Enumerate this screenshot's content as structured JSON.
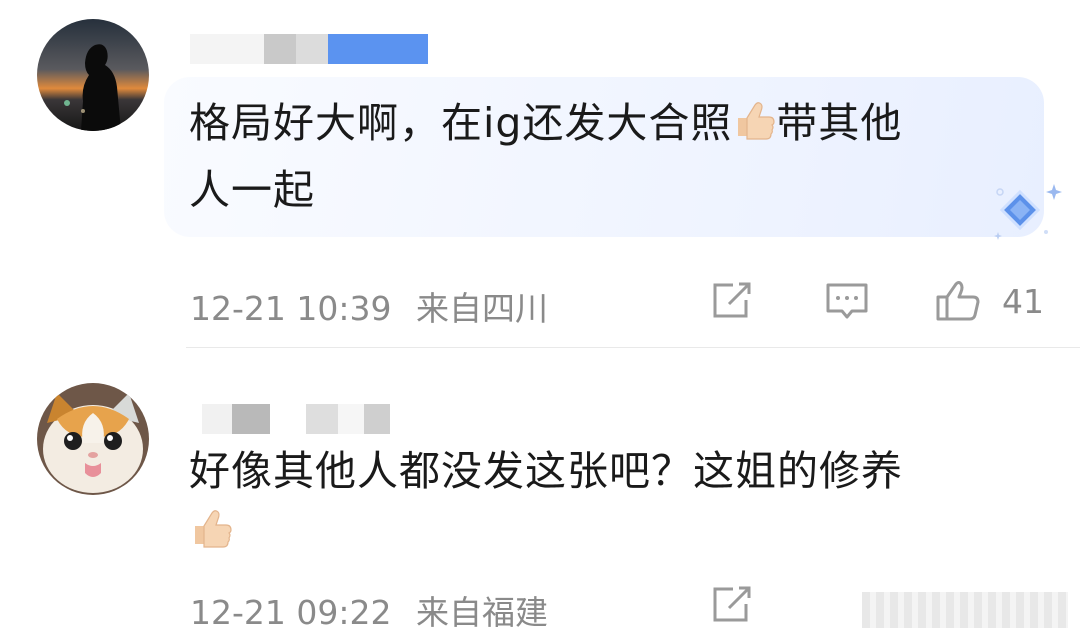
{
  "comments": [
    {
      "text_line1": "格局好大啊，在ig还发大合照",
      "text_line1_after": "带其他",
      "text_line2": "人一起",
      "timestamp": "12-21 10:39",
      "location": "来自四川",
      "like_count": "41",
      "emoji": "thumbs-up-icon"
    },
    {
      "text_line1": "好像其他人都没发这张吧？这姐的修养",
      "timestamp": "12-21 09:22",
      "location": "来自福建",
      "emoji": "thumbs-up-icon"
    }
  ],
  "colors": {
    "text": "#1a1a1a",
    "meta": "#8a8a8a",
    "bubble": "#eef3ff",
    "username_blur": "#5b93f0"
  }
}
